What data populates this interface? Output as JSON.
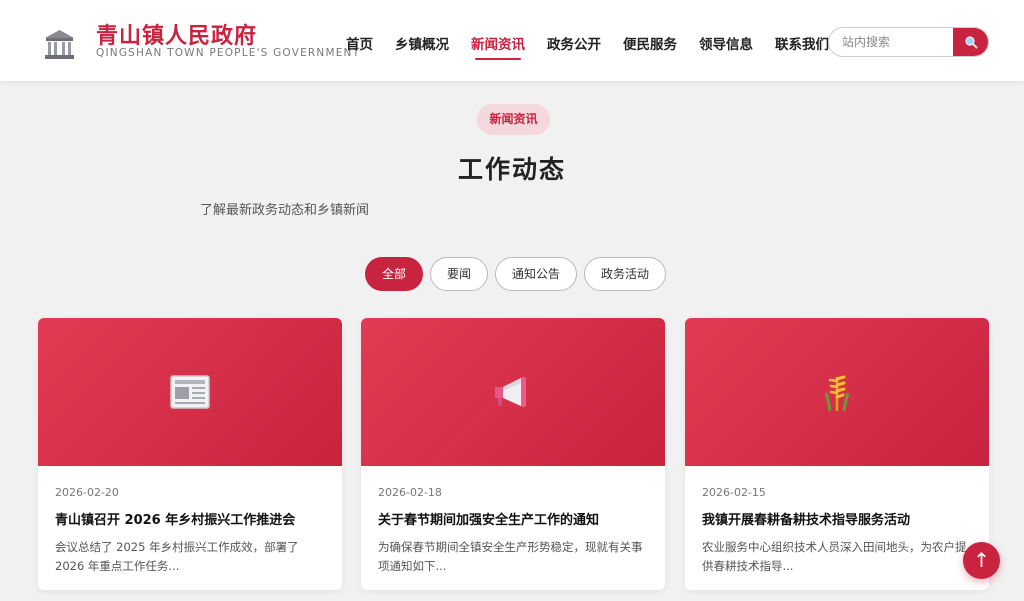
{
  "header": {
    "brand_cn": "青山镇人民政府",
    "brand_en": "QINGSHAN TOWN PEOPLE'S GOVERNMENT",
    "logo_icon": "government-building-icon",
    "nav": [
      {
        "label": "首页",
        "active": false
      },
      {
        "label": "乡镇概况",
        "active": false
      },
      {
        "label": "新闻资讯",
        "active": true
      },
      {
        "label": "政务公开",
        "active": false
      },
      {
        "label": "便民服务",
        "active": false
      },
      {
        "label": "领导信息",
        "active": false
      },
      {
        "label": "联系我们",
        "active": false
      }
    ],
    "search": {
      "placeholder": "站内搜索",
      "value": "",
      "icon": "search-icon"
    }
  },
  "section": {
    "pill": "新闻资讯",
    "title": "工作动态",
    "subtitle": "了解最新政务动态和乡镇新闻"
  },
  "filters": [
    {
      "label": "全部",
      "active": true
    },
    {
      "label": "要闻",
      "active": false
    },
    {
      "label": "通知公告",
      "active": false
    },
    {
      "label": "政务活动",
      "active": false
    }
  ],
  "cards": [
    {
      "date": "2026-02-20",
      "title": "青山镇召开 2026 年乡村振兴工作推进会",
      "summary": "会议总结了 2025 年乡村振兴工作成效，部署了 2026 年重点工作任务...",
      "icon": "newspaper-icon"
    },
    {
      "date": "2026-02-18",
      "title": "关于春节期间加强安全生产工作的通知",
      "summary": "为确保春节期间全镇安全生产形势稳定，现就有关事项通知如下...",
      "icon": "megaphone-icon"
    },
    {
      "date": "2026-02-15",
      "title": "我镇开展春耕备耕技术指导服务活动",
      "summary": "农业服务中心组织技术人员深入田间地头，为农户提供春耕技术指导...",
      "icon": "wheat-icon"
    }
  ],
  "back_to_top": {
    "label": "↑",
    "icon": "arrow-up-icon"
  },
  "colors": {
    "accent": "#c8233f",
    "accent_light": "#f5d8dd",
    "background": "#f1f1f1"
  }
}
